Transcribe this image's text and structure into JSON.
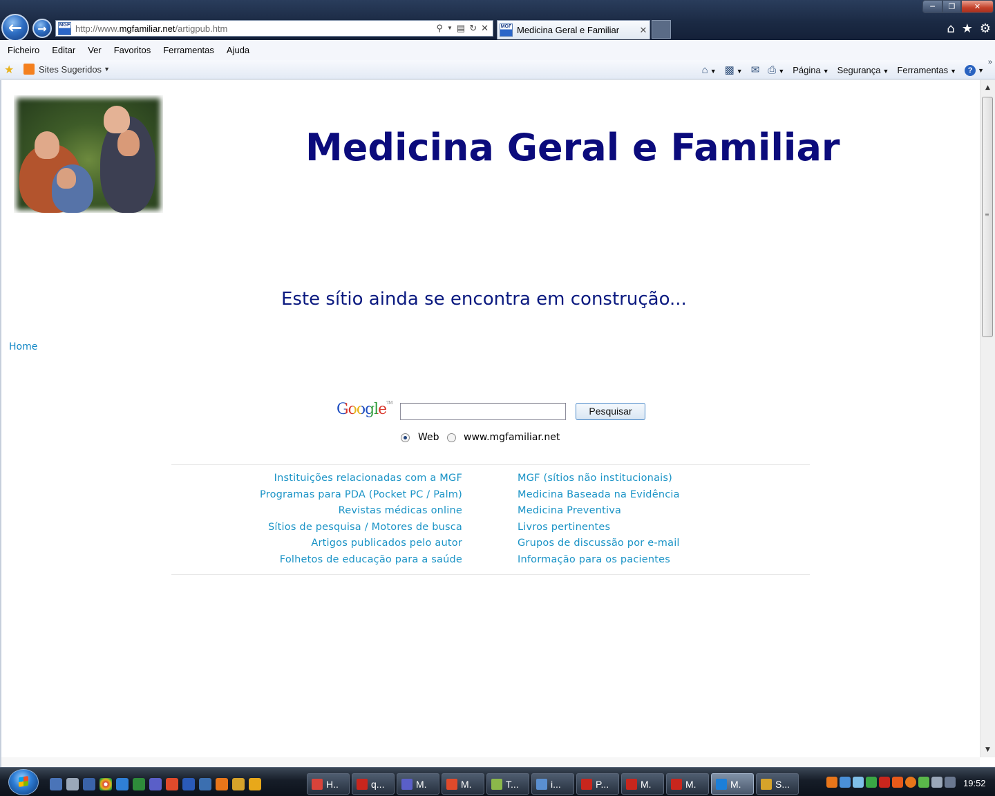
{
  "browser": {
    "address": {
      "prefix": "http://www.",
      "host": "mgfamiliar.net",
      "path": "/artigpub.htm",
      "favicon_text": "MGF"
    },
    "tab_title": "Medicina Geral e Familiar",
    "menu": [
      "Ficheiro",
      "Editar",
      "Ver",
      "Favoritos",
      "Ferramentas",
      "Ajuda"
    ],
    "favorites": {
      "suggested_sites": "Sites Sugeridos"
    },
    "command_bar": {
      "page": "Página",
      "security": "Segurança",
      "tools": "Ferramentas"
    },
    "icons": [
      "back-arrow-icon",
      "forward-arrow-icon",
      "search-icon",
      "compat-view-icon",
      "refresh-icon",
      "stop-icon",
      "home-icon",
      "favorites-star-icon",
      "tools-gear-icon",
      "rss-feed-icon",
      "read-mail-icon",
      "print-icon",
      "help-icon"
    ]
  },
  "page": {
    "title": "Medicina Geral e Familiar",
    "construction": "Este sítio ainda se encontra em construção...",
    "home_link": "Home",
    "search": {
      "logo": "Google",
      "logo_tm": "TM",
      "button": "Pesquisar",
      "value": "",
      "radio_web": "Web",
      "radio_site": "www.mgfamiliar.net",
      "selected": "Web"
    },
    "links_left": [
      "Instituições relacionadas com a MGF",
      "Programas para PDA (Pocket PC / Palm)",
      "Revistas médicas online",
      "Sítios de pesquisa / Motores de busca",
      "Artigos publicados pelo autor",
      "Folhetos de educação para a saúde"
    ],
    "links_right": [
      "MGF (sítios não institucionais)",
      "Medicina Baseada na Evidência",
      "Medicina Preventiva",
      "Livros pertinentes",
      "Grupos de discussão por e-mail",
      "Informação para os pacientes"
    ]
  },
  "taskbar": {
    "tasks": [
      {
        "label": "H..",
        "color": "#d9433a"
      },
      {
        "label": "q...",
        "color": "#c8261d"
      },
      {
        "label": "M.",
        "color": "#5a5fc8"
      },
      {
        "label": "M.",
        "color": "#e04a2b"
      },
      {
        "label": "T...",
        "color": "#8bb84a"
      },
      {
        "label": "i...",
        "color": "#5a8fd0"
      },
      {
        "label": "P...",
        "color": "#c8261d"
      },
      {
        "label": "M.",
        "color": "#c8261d"
      },
      {
        "label": "M.",
        "color": "#c8261d"
      },
      {
        "label": "M.",
        "color": "#1c7fd8"
      },
      {
        "label": "S...",
        "color": "#d6a32a"
      }
    ],
    "clock": "19:52"
  }
}
